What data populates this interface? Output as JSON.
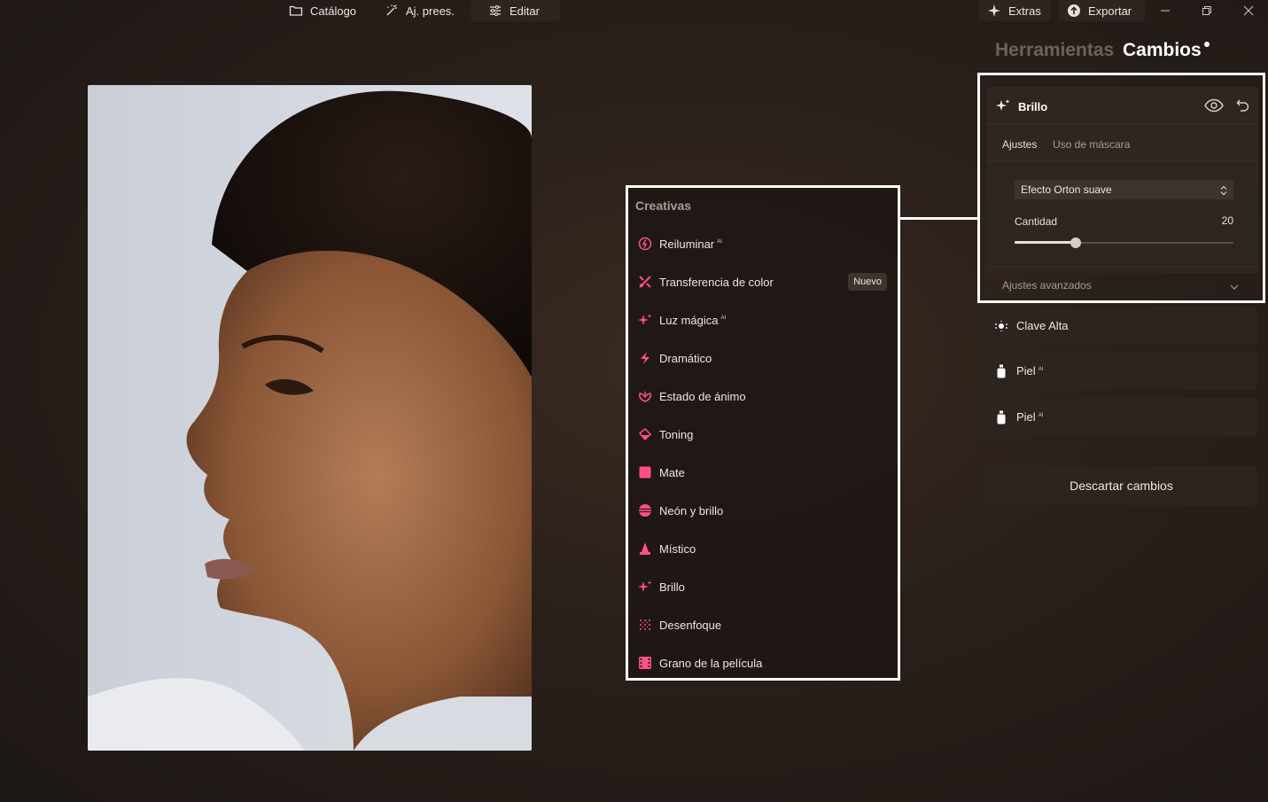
{
  "topbar": {
    "catalog": "Catálogo",
    "presets": "Aj. prees.",
    "edit": "Editar",
    "extras": "Extras",
    "export": "Exportar"
  },
  "panel": {
    "tab_tools": "Herramientas",
    "tab_changes": "Cambios"
  },
  "creative_menu": {
    "heading": "Creativas",
    "ai_tag": "AI",
    "items": [
      {
        "label": "Reiluminar",
        "ai": true,
        "icon": "relight-icon"
      },
      {
        "label": "Transferencia de color",
        "badge": "Nuevo",
        "icon": "color-transfer-icon"
      },
      {
        "label": "Luz mágica",
        "ai": true,
        "icon": "magic-light-icon"
      },
      {
        "label": "Dramático",
        "icon": "dramatic-icon"
      },
      {
        "label": "Estado de ánimo",
        "icon": "mood-icon"
      },
      {
        "label": "Toning",
        "icon": "toning-icon"
      },
      {
        "label": "Mate",
        "icon": "matte-icon"
      },
      {
        "label": "Neón y brillo",
        "icon": "neon-icon"
      },
      {
        "label": "Místico",
        "icon": "mystic-icon"
      },
      {
        "label": "Brillo",
        "icon": "glow-icon"
      },
      {
        "label": "Desenfoque",
        "icon": "blur-icon"
      },
      {
        "label": "Grano de la película",
        "icon": "film-grain-icon"
      }
    ]
  },
  "brillo": {
    "title": "Brillo",
    "tab_adjust": "Ajustes",
    "tab_mask": "Uso de máscara",
    "select_value": "Efecto Orton suave",
    "amount_label": "Cantidad",
    "amount_value": "20",
    "amount_fraction": 0.2,
    "advanced": "Ajustes avanzados"
  },
  "changes": [
    {
      "label": "Clave Alta",
      "ai": false
    },
    {
      "label": "Piel",
      "ai": true
    },
    {
      "label": "Piel",
      "ai": true
    }
  ],
  "discard": "Descartar cambios",
  "colors": {
    "accent": "#ff4f8b",
    "panel": "#2d241f",
    "highlight": "#ffffff"
  }
}
